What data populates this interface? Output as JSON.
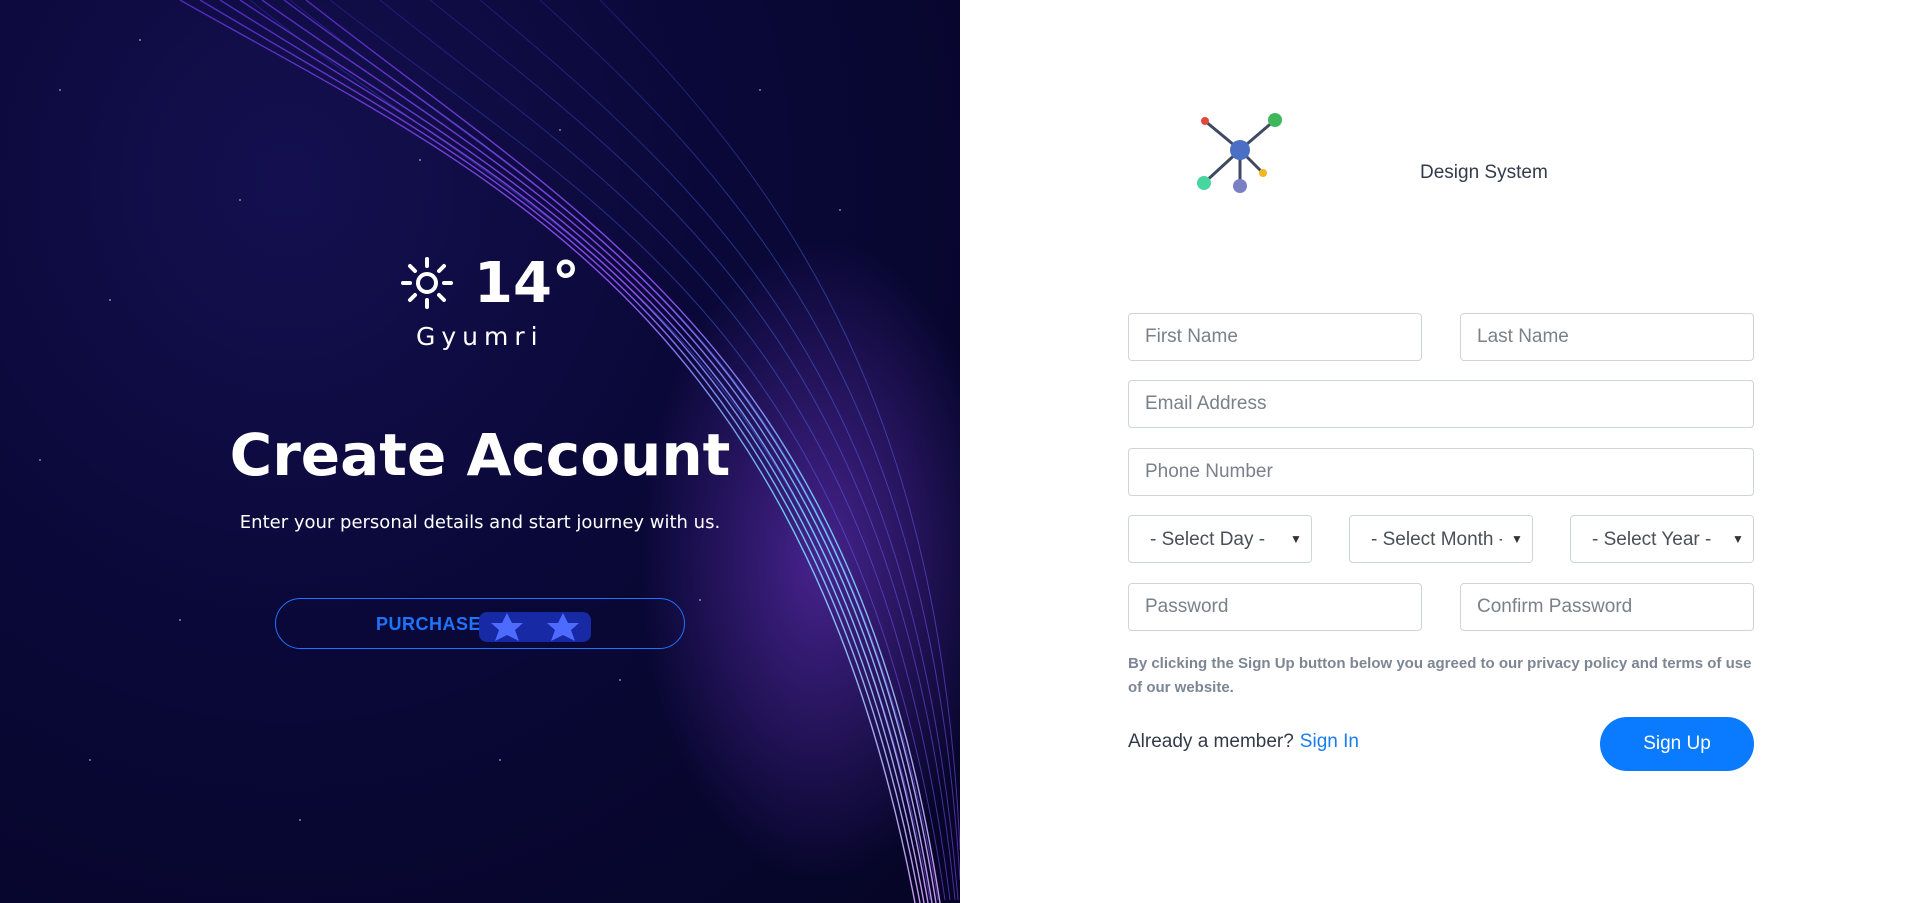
{
  "hero": {
    "temperature": "14°",
    "city": "Gyumri",
    "title": "Create Account",
    "subtitle": "Enter your personal details and start journey with us.",
    "purchase_label": "PURCHASE",
    "weather_icon": "sun-icon",
    "colors": {
      "background": "#0a0838",
      "accent": "#1e74ff"
    }
  },
  "brand": {
    "name": "Design System",
    "logo_icon": "network-logo",
    "logo_colors": [
      "#4a6fc4",
      "#e0493d",
      "#3db85a",
      "#48d6a0",
      "#f2b620",
      "#7b7fc4"
    ]
  },
  "form": {
    "first_name_placeholder": "First Name",
    "last_name_placeholder": "Last Name",
    "email_placeholder": "Email Address",
    "phone_placeholder": "Phone Number",
    "select_day": "- Select Day -",
    "select_month": "- Select Month -",
    "select_year": "- Select Year -",
    "password_placeholder": "Password",
    "confirm_password_placeholder": "Confirm Password",
    "terms_text": "By clicking the Sign Up button below you agreed to our privacy policy and terms of use of our website.",
    "member_text": "Already a member?",
    "signin_link": "Sign In",
    "signup_button": "Sign Up",
    "colors": {
      "primary": "#0a7bff",
      "link": "#1a7cf0",
      "muted": "#7d8694"
    }
  }
}
